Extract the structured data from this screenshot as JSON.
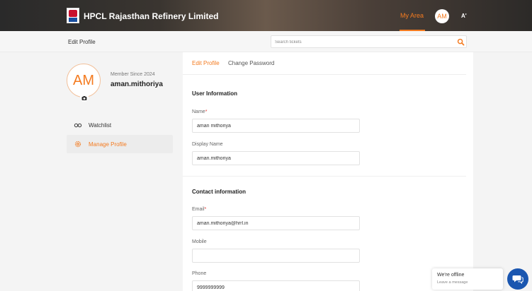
{
  "header": {
    "brand": "HPCL Rajasthan Refinery Limited",
    "my_area": "My Area",
    "avatar_initials": "AM",
    "font_size_label": "A'"
  },
  "subbar": {
    "page_title": "Edit Profile",
    "search_placeholder": "Search tickets"
  },
  "profile": {
    "initials": "AM",
    "member_since": "Member Since 2024",
    "username": "aman.mithoriya"
  },
  "nav": {
    "watchlist": "Watchlist",
    "manage_profile": "Manage Profile"
  },
  "tabs": {
    "edit_profile": "Edit Profile",
    "change_password": "Change Password"
  },
  "user_info": {
    "title": "User Information",
    "name_label": "Name",
    "name_value": "aman mithoriya",
    "display_name_label": "Display Name",
    "display_name_value": "aman.mithoriya"
  },
  "contact_info": {
    "title": "Contact information",
    "email_label": "Email",
    "email_value": "aman.mithoriya@hrrl.in",
    "mobile_label": "Mobile",
    "mobile_value": "",
    "phone_label": "Phone",
    "phone_value": "9999999999"
  },
  "required_marker": "*",
  "chat": {
    "title": "We're offline",
    "subtitle": "Leave a message"
  },
  "colors": {
    "accent": "#f47b20",
    "chat_blue": "#1a56b0",
    "required": "#e53935"
  }
}
